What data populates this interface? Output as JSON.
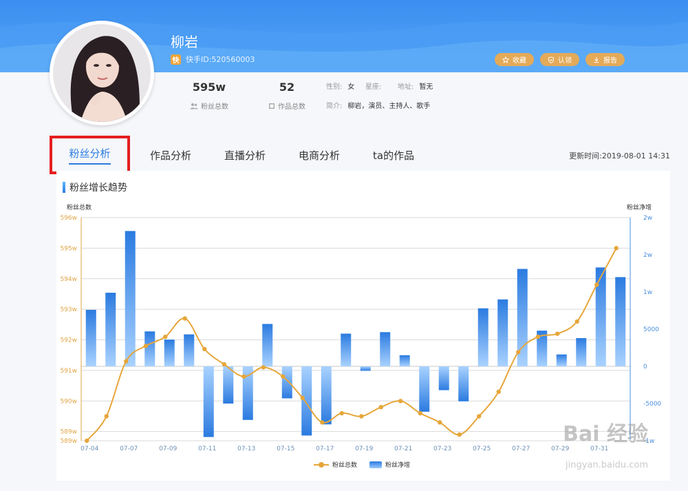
{
  "profile": {
    "name": "柳岩",
    "uid": "快手ID:520560003",
    "uid_badge": "快",
    "fans_value": "595w",
    "fans_label": "粉丝总数",
    "works_value": "52",
    "works_label": "作品总数",
    "gender_key": "性别:",
    "gender_val": "女",
    "zodiac_key": "星座:",
    "zodiac_val": "",
    "address_key": "地址:",
    "address_val": "暂无",
    "intro_key": "简介:",
    "intro_val": "柳岩，演员、主持人、歌手"
  },
  "actions": [
    {
      "label": "收藏",
      "icon": "star-icon"
    },
    {
      "label": "认领",
      "icon": "shield-icon"
    },
    {
      "label": "报告",
      "icon": "download-icon"
    }
  ],
  "tabs": [
    "粉丝分析",
    "作品分析",
    "直播分析",
    "电商分析",
    "ta的作品"
  ],
  "updated": "更新时间:2019-08-01 14:31",
  "card_title": "粉丝增长趋势",
  "watermark": "Bai 经验",
  "watermark_url": "jingyan.baidu.com",
  "colors": {
    "line": "#e6a63a",
    "bar_top": "#2b7be0",
    "bar_bottom": "#a9d2ff",
    "banner": "#3b8ef0",
    "highlight": "#e51e1e"
  },
  "chart_data": {
    "type": "bar+line",
    "left_axis_title": "粉丝总数",
    "right_axis_title": "粉丝净增",
    "left_ticks": [
      "596w",
      "595w",
      "594w",
      "593w",
      "592w",
      "591w",
      "590w",
      "589w",
      "589w"
    ],
    "left_tick_values": [
      596,
      595,
      594,
      593,
      592,
      591,
      590,
      589,
      588.7
    ],
    "right_ticks": [
      "2w",
      "2w",
      "1w",
      "5000",
      "0",
      "-5000",
      "-1w"
    ],
    "right_tick_values": [
      20000,
      15000,
      10000,
      5000,
      0,
      -5000,
      -10000
    ],
    "x_tick_labels": [
      "07-04",
      "07-07",
      "07-09",
      "07-11",
      "07-13",
      "07-15",
      "07-17",
      "07-19",
      "07-21",
      "07-23",
      "07-25",
      "07-27",
      "07-29",
      "07-31"
    ],
    "x": [
      "07-04",
      "07-05",
      "07-06",
      "07-07",
      "07-08",
      "07-09",
      "07-10",
      "07-11",
      "07-12",
      "07-13",
      "07-14",
      "07-15",
      "07-16",
      "07-17",
      "07-18",
      "07-19",
      "07-20",
      "07-21",
      "07-22",
      "07-23",
      "07-24",
      "07-25",
      "07-26",
      "07-27",
      "07-28",
      "07-29",
      "07-30",
      "07-31",
      "08-01"
    ],
    "series": [
      {
        "name": "粉丝总数",
        "axis": "left",
        "kind": "line",
        "values": [
          588.7,
          589.5,
          591.3,
          591.8,
          592.1,
          592.7,
          591.7,
          591.2,
          590.8,
          591.1,
          590.8,
          590.1,
          589.3,
          589.6,
          589.5,
          589.8,
          590.0,
          589.6,
          589.3,
          588.9,
          589.5,
          590.3,
          591.6,
          592.1,
          592.2,
          592.6,
          593.8,
          595.0,
          null
        ]
      },
      {
        "name": "粉丝净增",
        "axis": "right",
        "kind": "bar",
        "values": [
          7600,
          9900,
          18200,
          4700,
          3600,
          4300,
          -9500,
          -5000,
          -7200,
          5700,
          -4300,
          -9300,
          -7800,
          4400,
          -600,
          4600,
          1500,
          -6100,
          -3200,
          -4700,
          7800,
          9000,
          13100,
          4800,
          1600,
          3800,
          13300,
          12000
        ]
      }
    ],
    "line_values": [
      588.7,
      589.5,
      591.3,
      591.8,
      592.1,
      592.7,
      591.7,
      591.2,
      590.8,
      591.1,
      590.8,
      590.1,
      589.3,
      589.6,
      589.5,
      589.8,
      590.0,
      589.6,
      589.3,
      588.9,
      589.5,
      590.3,
      591.6,
      592.1,
      592.2,
      592.6,
      593.8,
      595.0
    ],
    "legend": [
      "粉丝总数",
      "粉丝净增"
    ],
    "legend_position": "bottom-center",
    "grid": true
  }
}
